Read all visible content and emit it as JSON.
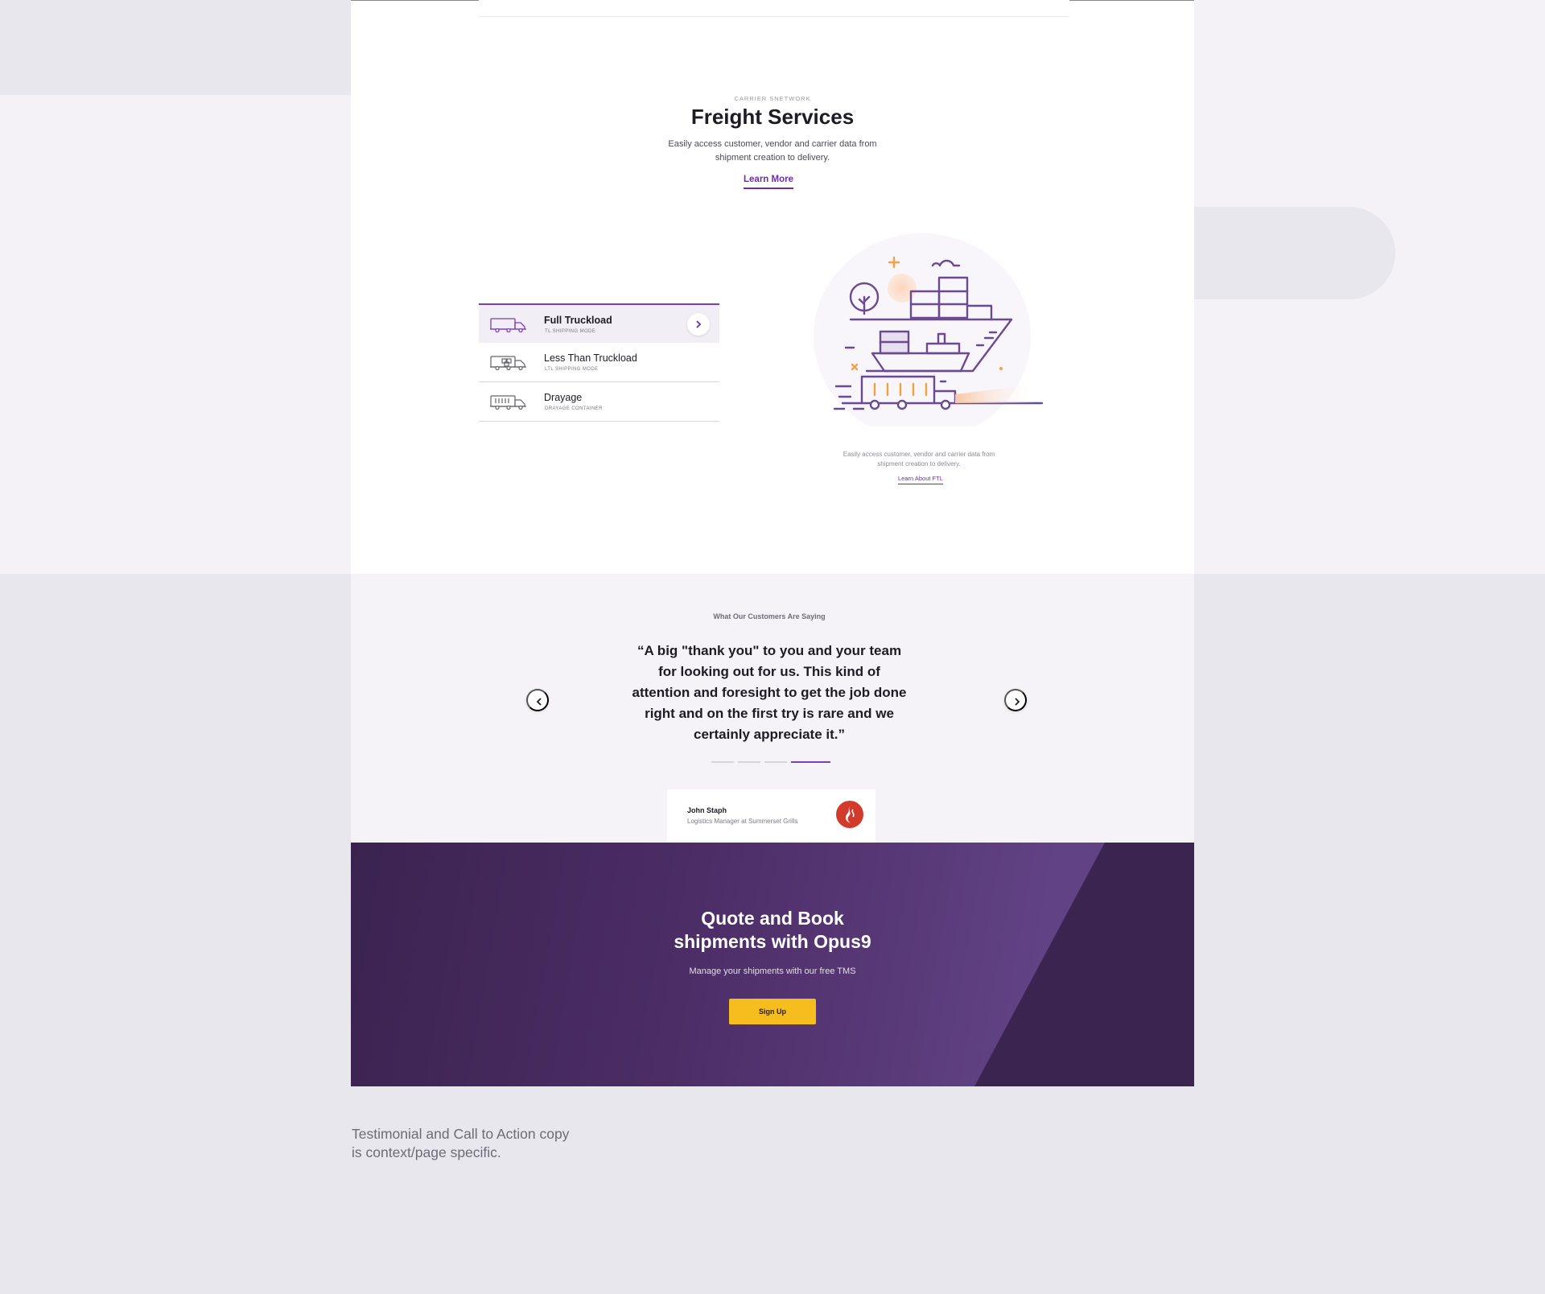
{
  "freight": {
    "eyebrow": "CARRIER SNETWORK",
    "title": "Freight Services",
    "description": "Easily access customer, vendor and carrier data from shipment creation to delivery.",
    "learn_more": "Learn More",
    "modes": [
      {
        "name": "Full Truckload",
        "sub": "TL SHIPPING MODE",
        "icon": "truck-icon",
        "active": true
      },
      {
        "name": "Less Than Truckload",
        "sub": "LTL SHIPPING MODE",
        "icon": "ltl-truck-icon",
        "active": false
      },
      {
        "name": "Drayage",
        "sub": "DRAYAGE CONTAINER",
        "icon": "container-truck-icon",
        "active": false
      }
    ],
    "illustration_caption": "Easily access customer, vendor and carrier data from shipment creation to delivery.",
    "illustration_link": "Learn About FTL"
  },
  "testimonials": {
    "eyebrow": "What Our Customers Are Saying",
    "quote": "“A big \"thank you\" to you and your team for looking out for us. This kind of attention and foresight to get the job done right and on the first try is rare and we certainly appreciate it.”",
    "active_index": 3,
    "count": 4,
    "author_name": "John Staph",
    "author_role": "Logistics Manager at Summerset Grills"
  },
  "cta": {
    "title_line1": "Quote and Book",
    "title_line2": "shipments with Opus9",
    "description": "Manage your shipments with our free TMS",
    "button": "Sign Up"
  },
  "note": {
    "line1": "Testimonial and Call to Action copy",
    "line2": "is context/page specific."
  },
  "colors": {
    "accent": "#7a3fb5",
    "cta_button": "#f5bd1d",
    "cta_background": "#4c2d66"
  }
}
